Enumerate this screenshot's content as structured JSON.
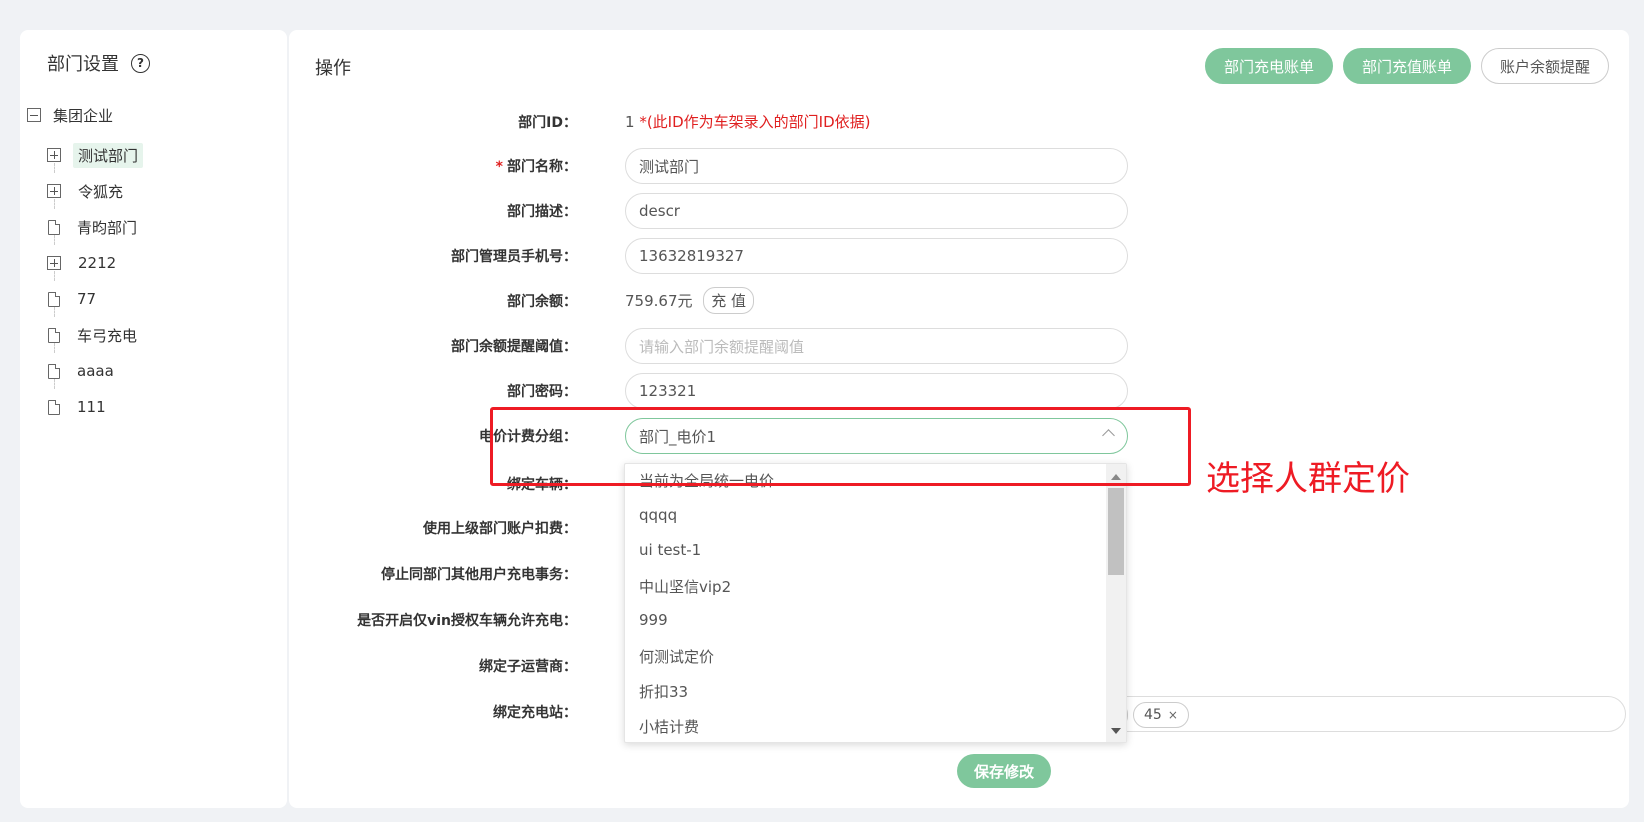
{
  "sidebar": {
    "title": "部门设置",
    "help_icon": "?",
    "root_label": "集团企业",
    "items": [
      {
        "label": "测试部门",
        "type": "folder",
        "selected": true
      },
      {
        "label": "令狐充",
        "type": "folder"
      },
      {
        "label": "青昀部门",
        "type": "file"
      },
      {
        "label": "2212",
        "type": "folder"
      },
      {
        "label": "77",
        "type": "file"
      },
      {
        "label": "车弓充电",
        "type": "file"
      },
      {
        "label": "aaaa",
        "type": "file"
      },
      {
        "label": "111",
        "type": "file"
      }
    ]
  },
  "main": {
    "title": "操作",
    "buttons": {
      "charge_bill": "部门充电账单",
      "recharge_bill": "部门充值账单",
      "balance_alert": "账户余额提醒"
    },
    "form": {
      "dept_id_label": "部门ID：",
      "dept_id_value": "1",
      "dept_id_note": "*(此ID作为车架录入的部门ID依据)",
      "name_label": "部门名称：",
      "name_value": "测试部门",
      "desc_label": "部门描述：",
      "desc_value": "descr",
      "phone_label": "部门管理员手机号：",
      "phone_value": "13632819327",
      "balance_label": "部门余额：",
      "balance_value": "759.67元",
      "recharge_button": "充 值",
      "threshold_label": "部门余额提醒阈值：",
      "threshold_placeholder": "请输入部门余额提醒阈值",
      "password_label": "部门密码：",
      "password_value": "123321",
      "pricing_label": "电价计费分组：",
      "pricing_value": "部门_电价1",
      "bind_vehicle_label": "绑定车辆：",
      "parent_account_label": "使用上级部门账户扣费：",
      "stop_others_label": "停止同部门其他用户充电事务：",
      "vin_only_label": "是否开启仅vin授权车辆允许充电：",
      "bind_operator_label": "绑定子运营商：",
      "bind_station_label": "绑定充电站：",
      "station_tag": "45",
      "station_tag_close": "×",
      "save_button": "保存修改"
    },
    "dropdown_options": [
      "当前为全局统一电价",
      "qqqq",
      "ui test-1",
      "中山坚信vip2",
      "999",
      "何测试定价",
      "折扣33",
      "小桔计费"
    ]
  },
  "annotation": {
    "text": "选择人群定价",
    "color": "#ee1b24"
  },
  "colors": {
    "accent": "#7fc79c",
    "required": "#e02020"
  }
}
